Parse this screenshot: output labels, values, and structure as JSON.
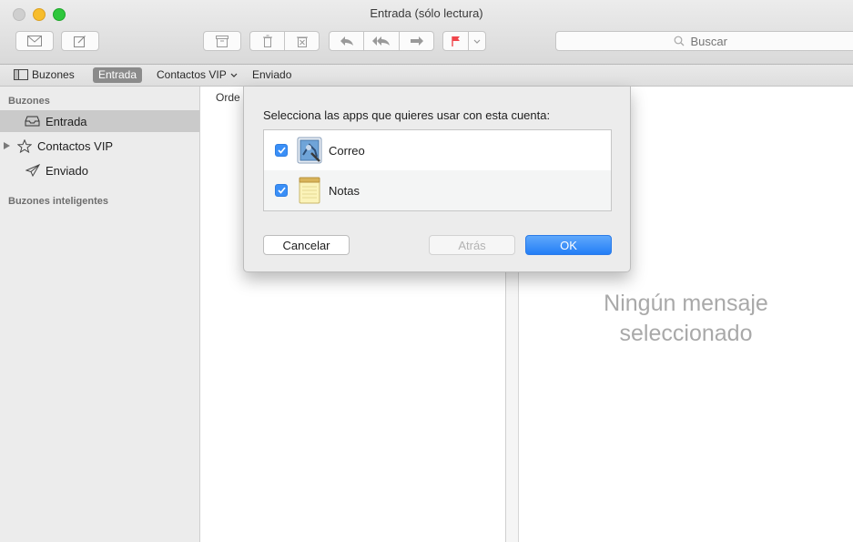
{
  "window": {
    "title": "Entrada (sólo lectura)"
  },
  "toolbar": {
    "search_placeholder": "Buscar"
  },
  "favorites_bar": {
    "mailboxes_label": "Buzones",
    "inbox_label": "Entrada",
    "vip_label": "Contactos VIP",
    "sent_label": "Enviado"
  },
  "sidebar": {
    "heading": "Buzones",
    "items": [
      {
        "label": "Entrada",
        "icon": "inbox-tray-icon",
        "selected": true
      },
      {
        "label": "Contactos VIP",
        "icon": "star-icon",
        "selected": false
      },
      {
        "label": "Enviado",
        "icon": "paper-plane-icon",
        "selected": false
      }
    ],
    "smart_heading": "Buzones inteligentes"
  },
  "message_list": {
    "sort_label": "Orde"
  },
  "viewer": {
    "line1": "Ningún mensaje",
    "line2": "seleccionado"
  },
  "sheet": {
    "prompt": "Selecciona las apps que quieres usar con esta cuenta:",
    "apps": [
      {
        "name": "Correo",
        "checked": true,
        "icon": "mail-stamp-icon"
      },
      {
        "name": "Notas",
        "checked": true,
        "icon": "notes-pad-icon"
      }
    ],
    "cancel_label": "Cancelar",
    "back_label": "Atrás",
    "ok_label": "OK"
  },
  "colors": {
    "accent": "#237ef6",
    "flag": "#f0454b"
  }
}
